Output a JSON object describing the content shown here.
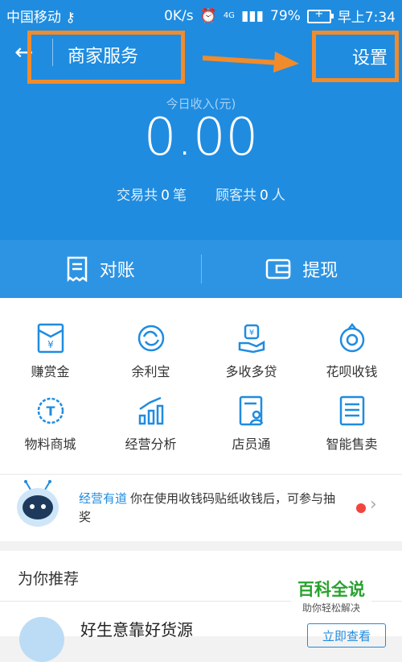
{
  "status_bar": {
    "carrier": "中国移动",
    "speed": "0K/s",
    "network": "4G",
    "battery": "79%",
    "time": "早上7:34"
  },
  "header": {
    "back_icon": "arrow-left-icon",
    "title": "商家服务",
    "settings_label": "设置"
  },
  "annotation": {
    "color": "#f28b2b"
  },
  "income": {
    "label": "今日收入(元)",
    "amount": "0.00",
    "tx_prefix": "交易共",
    "tx_count": "0",
    "tx_unit": "笔",
    "cust_prefix": "顾客共",
    "cust_count": "0",
    "cust_unit": "人"
  },
  "actions": [
    {
      "icon": "receipt-icon",
      "label": "对账"
    },
    {
      "icon": "wallet-icon",
      "label": "提现"
    }
  ],
  "services": [
    {
      "icon": "envelope-yuan-icon",
      "label": "赚赏金"
    },
    {
      "icon": "yu-e-bao-icon",
      "label": "余利宝"
    },
    {
      "icon": "hand-money-icon",
      "label": "多收多贷"
    },
    {
      "icon": "huabei-icon",
      "label": "花呗收钱"
    },
    {
      "icon": "t-badge-icon",
      "label": "物料商城"
    },
    {
      "icon": "bar-chart-icon",
      "label": "经营分析"
    },
    {
      "icon": "staff-id-icon",
      "label": "店员通"
    },
    {
      "icon": "vending-icon",
      "label": "智能售卖"
    }
  ],
  "notice": {
    "brand": "经营有道",
    "text": "你在使用收钱码贴纸收钱后，可参与抽奖"
  },
  "recommend": {
    "title": "为你推荐",
    "item_title": "好生意靠好货源",
    "button": "立即查看"
  },
  "watermark": {
    "line1": "百科全说",
    "line2": "助你轻松解决"
  },
  "colors": {
    "primary": "#1f8ce0",
    "icon": "#1f8ce0"
  }
}
